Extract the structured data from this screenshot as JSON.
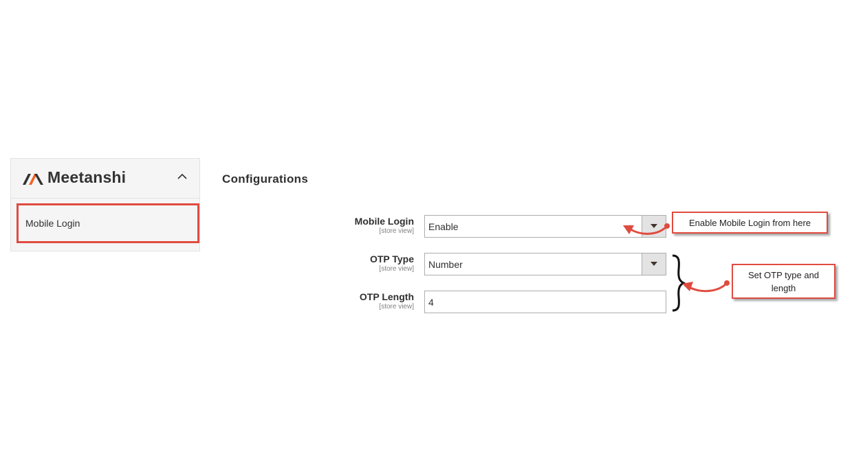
{
  "sidebar": {
    "brand": "Meetanshi",
    "items": [
      {
        "label": "Mobile Login"
      }
    ]
  },
  "main": {
    "title": "Configurations",
    "fields": [
      {
        "label": "Mobile Login",
        "scope": "[store view]",
        "value": "Enable"
      },
      {
        "label": "OTP Type",
        "scope": "[store view]",
        "value": "Number"
      },
      {
        "label": "OTP Length",
        "scope": "[store view]",
        "value": "4"
      }
    ]
  },
  "callouts": [
    {
      "text": "Enable Mobile Login from here"
    },
    {
      "text": "Set OTP type and length"
    }
  ],
  "colors": {
    "accent": "#e04b3f",
    "brand_dark": "#333333",
    "brand_orange": "#f26322"
  }
}
